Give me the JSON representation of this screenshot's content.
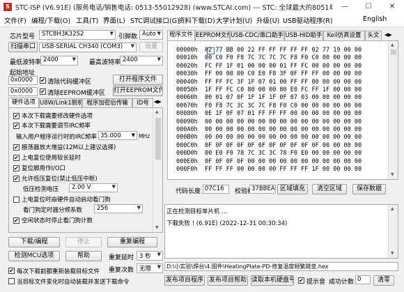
{
  "window": {
    "title": "STC-ISP (V6.91E) (服务电话/销售电话: 0513-55012928) (www.STCAI.com) --- STC: 全球最大的8051单片机设计...",
    "controls": [
      "—",
      "☐",
      "✕"
    ]
  },
  "menu": [
    "文件(F)",
    "编程/下载(O)",
    "工具(T)",
    "界面(L)",
    "STC调试接口(G)",
    "资料下载(D)",
    "大学计划(U)",
    "升级(U)",
    "USB驱动程序(R)",
    "English"
  ],
  "left": {
    "chip_label": "芯片型号",
    "chip_value": "STC8H3K32S2",
    "pin_label": "引脚数",
    "pin_value": "Auto",
    "scan_label": "扫描串口",
    "port_value": "USB-SERIAL CH340 (COM3)",
    "settings_button": "设置",
    "min_baud_label": "最低波特率",
    "min_baud_value": "2400",
    "max_baud_label": "最高波特率",
    "max_baud_value": "2400",
    "start_addr_label": "起始地址",
    "addr1": "0x0000",
    "clear_code": "清除代码缓冲区",
    "open_program": "打开程序文件",
    "addr2": "0x0000",
    "clear_eeprom": "清除EEPROM缓冲区",
    "open_eeprom": "打开EEPROM文件",
    "tabs": [
      "硬件选项",
      "U8W/Link1脱机",
      "程序加密后传输",
      "ID号"
    ],
    "options": [
      {
        "text": "本次下载需要修改硬件选项",
        "checked": true
      },
      {
        "text": "本次下载需要调节IRC频率",
        "checked": true
      },
      {
        "text": "振荡器放大增益(12M以上建议选择)",
        "checked": true
      },
      {
        "text": "上电复位使用较长延时",
        "checked": true
      },
      {
        "text": "复位脚用作I/O口",
        "checked": true
      },
      {
        "text": "允许低压复位(禁止低压中断)",
        "checked": true
      },
      {
        "text": "上电复位时由硬件自动启动看门狗",
        "checked": false
      },
      {
        "text": "空闲状态时停止看门狗计数",
        "checked": true
      }
    ],
    "irc_label": "输入用户程序运行时的IRC频率",
    "irc_value": "35.000",
    "irc_unit": "MHz",
    "lvd_label": "低压检测电压",
    "lvd_value": "2.00 V",
    "wdt_label": "看门狗定时器分频系数",
    "wdt_value": "256",
    "download_button": "下载/编程",
    "stop_button": "停止",
    "reprogram_button": "重复编程",
    "detect_button": "检测MCU选项",
    "help_button": "帮助",
    "repeat_delay_label": "重复延时",
    "repeat_delay_value": "3 秒",
    "repeat_count_label": "重复次数",
    "repeat_count_value": "无限",
    "reload_label": "每次下载前都重新装载目标文件",
    "reload_checked": true,
    "auto_load_label": "当目标文件变化时自动装载并发送下载命令",
    "auto_load_checked": false
  },
  "right": {
    "tabs": [
      "程序文件",
      "EEPROM文件",
      "USB-CDC/串口助手",
      "USB-HID助手",
      "Keil仿真设置",
      "头文"
    ],
    "hex_rows": [
      {
        "addr": "00000h",
        "bytes": "02 77 BB 00 22 FF FF FF FF FF 02 77 19 00 00"
      },
      {
        "addr": "00010h",
        "bytes": "00 C0 F0 F8 7C 7C 7C 7C F8 F0 C0 00 00 00 00"
      },
      {
        "addr": "00020h",
        "bytes": "FC FF 1F 01 00 00 00 01 FF FC 00 00 00 00 00"
      },
      {
        "addr": "00030h",
        "bytes": "FF 00 00 00 C0 E0 F8 3F 0F FF FF 00 00 00 00"
      },
      {
        "addr": "00040h",
        "bytes": "FF FF FC 3F 1F 07 01 00 FF FF 00 00 00 00 00"
      },
      {
        "addr": "00050h",
        "bytes": "1F FF FC C0 80 00 00 80 E0 FC FF 1F 00 00 00"
      },
      {
        "addr": "00060h",
        "bytes": "00 01 07 0F 1F 1F 1F 0F 07 03 00 00 00 00 00"
      },
      {
        "addr": "00070h",
        "bytes": "F0 F8 7C 3C 3C 7C F8 F0 C0 00 00 00 00 00 00"
      },
      {
        "addr": "00080h",
        "bytes": "0E 1F 0F 07 01 FF FF FF 00 00 00 00 00 00 00"
      },
      {
        "addr": "00090h",
        "bytes": "00 00 00 00 00 00 00 00 00 00 00 00 00 00 00"
      },
      {
        "addr": "000A0h",
        "bytes": "00 00 00 00 00 00 00 00 00 00 00 00 00 00 00"
      },
      {
        "addr": "000B0h",
        "bytes": "00 00 00 00 00 00 00 00 00 00 00 00 00 00 00"
      },
      {
        "addr": "000C0h",
        "bytes": "0F 0F 0F 0F 0F 0F 0F 0F 0F 0F 0F 00 00 00 00"
      },
      {
        "addr": "000D0h",
        "bytes": "00 E0 F0 78 7C 3C 3C 78 F0 E0 00 00 00 00 00"
      },
      {
        "addr": "000E0h",
        "bytes": "0F 0F 0F 0F 00 00 00 00 00 00 00 00 00 00 00"
      },
      {
        "addr": "000F0h",
        "bytes": "FF FF FF 00 00 00 00 FF FF FF 1F 00 00 00 00"
      }
    ],
    "checksum_label": "代码长度",
    "checksum_value": "07C16",
    "sum_label": "校验和",
    "sum_value": "37BBEA",
    "fill_button": "区域填充",
    "clear_button": "清空区域",
    "save_button": "保存数据",
    "log_lines": [
      "正在检测目标单片机 ...",
      "",
      "下载失败 !  (6.91E) (2022-12-31 00:30:34)"
    ],
    "file_path": "D:\\小实验\\焊台\\4.固件\\HeatingPlate-PD-修复温度频繁跳变.hex",
    "publish_project": "发布项目程序",
    "publish_help": "发布项目帮助",
    "read_serial": "读取本机硬盘号",
    "beep_label": "提示音",
    "beep_checked": true,
    "success_count_label": "成功计数",
    "success_count_value": "0",
    "clear_count_button": "清零"
  }
}
